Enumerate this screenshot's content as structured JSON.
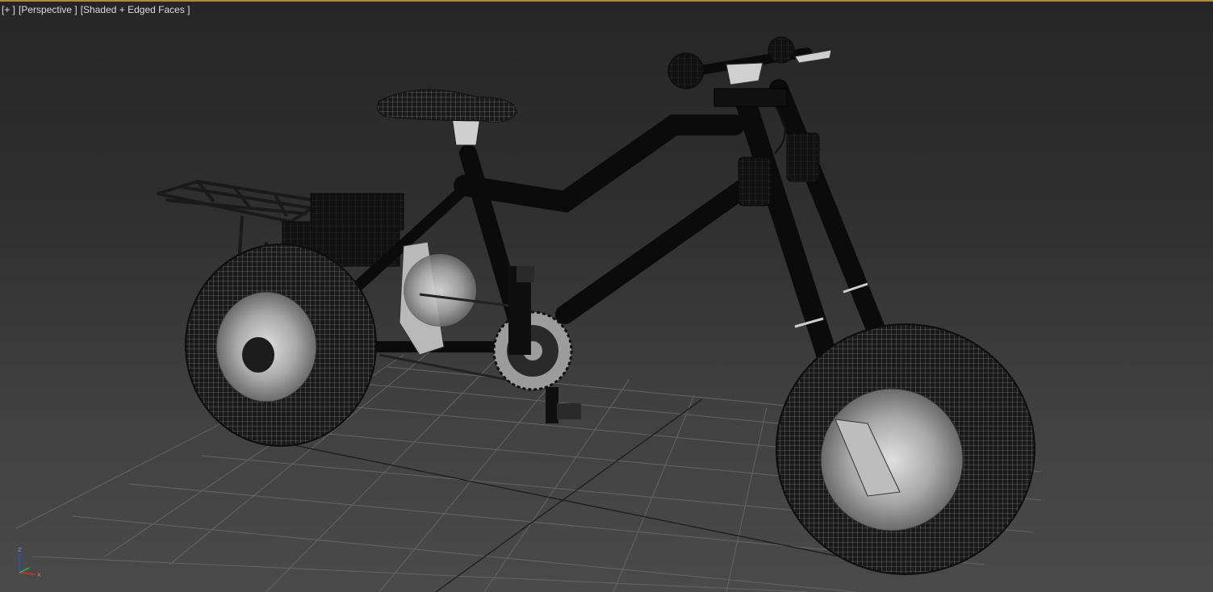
{
  "viewport": {
    "label_plus": "[+ ]",
    "label_view": "[Perspective ]",
    "label_shading": "[Shaded + Edged Faces ]",
    "active": true,
    "border_color": "#b08a3c",
    "grid_color": "#6a6a6a"
  },
  "scene": {
    "object": "bicycle-3d-model",
    "display_mode": "Shaded + Edged Faces"
  },
  "gizmo": {
    "z_label": "z",
    "x_label": "x",
    "colors": {
      "z": "#2a4fe0",
      "x": "#d03030",
      "y": "#30c030"
    }
  }
}
